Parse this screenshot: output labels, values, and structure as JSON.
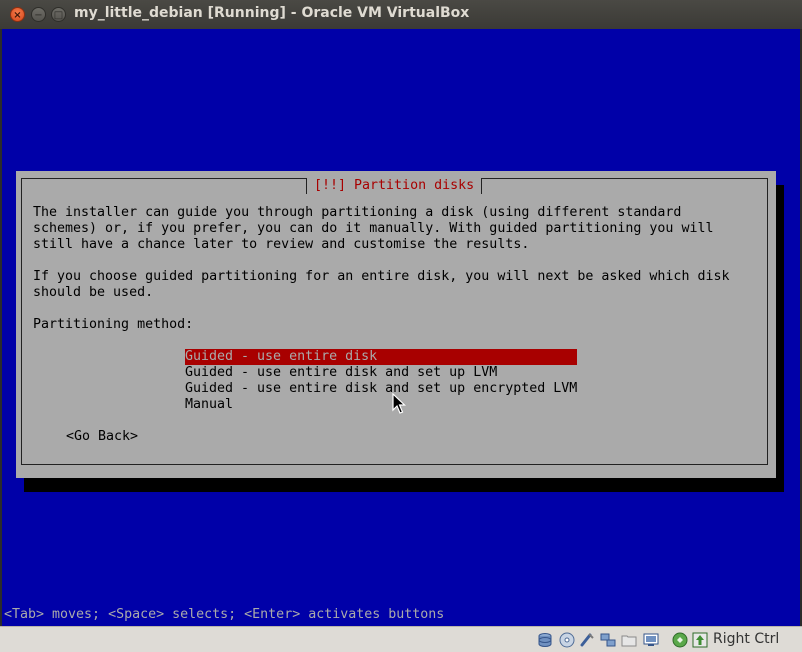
{
  "window": {
    "title": "my_little_debian [Running] - Oracle VM VirtualBox",
    "controls": {
      "close": "×",
      "minimize": "−",
      "maximize": "□"
    }
  },
  "installer": {
    "dialog_title": "[!!] Partition disks",
    "paragraph1": "The installer can guide you through partitioning a disk (using different standard\nschemes) or, if you prefer, you can do it manually. With guided partitioning you will\nstill have a chance later to review and customise the results.",
    "paragraph2": "If you choose guided partitioning for an entire disk, you will next be asked which disk\nshould be used.",
    "method_label": "Partitioning method:",
    "options": [
      {
        "label": "Guided - use entire disk",
        "selected": true
      },
      {
        "label": "Guided - use entire disk and set up LVM",
        "selected": false
      },
      {
        "label": "Guided - use entire disk and set up encrypted LVM",
        "selected": false
      },
      {
        "label": "Manual",
        "selected": false
      }
    ],
    "go_back": "<Go Back>",
    "help_line": "<Tab> moves; <Space> selects; <Enter> activates buttons"
  },
  "statusbar": {
    "icons": [
      "hard-disk-icon",
      "optical-drive-icon",
      "usb-icon",
      "network-icon",
      "shared-folder-icon",
      "display-icon",
      "capture-icon",
      "mouse-integration-icon"
    ],
    "host_key": "Right Ctrl"
  },
  "colors": {
    "screen_bg": "#0000a8",
    "dialog_bg": "#aaaaaa",
    "title_red": "#a80000",
    "selection_bg": "#a80000"
  }
}
